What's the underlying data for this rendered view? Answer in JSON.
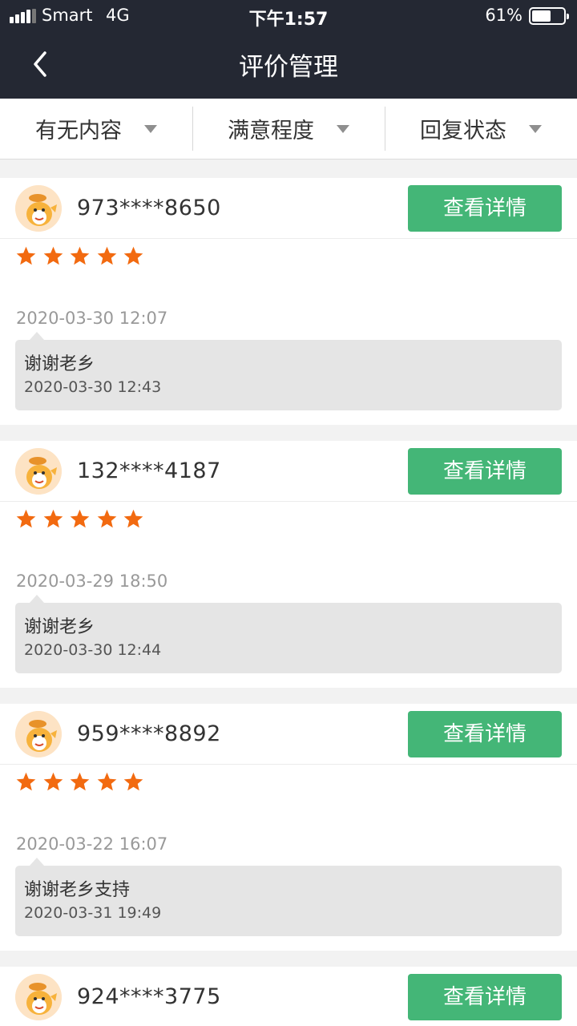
{
  "status_bar": {
    "carrier": "Smart",
    "network": "4G",
    "time": "下午1:57",
    "battery": "61%",
    "battery_level": 0.61
  },
  "navbar": {
    "title": "评价管理",
    "back_icon": "chevron-left-icon"
  },
  "filters": [
    {
      "label": "有无内容",
      "icon": "caret-down-icon"
    },
    {
      "label": "满意程度",
      "icon": "caret-down-icon"
    },
    {
      "label": "回复状态",
      "icon": "caret-down-icon"
    }
  ],
  "reviews": [
    {
      "user": "973****8650",
      "button": "查看详情",
      "rating": 5,
      "rated_at": "2020-03-30 12:07",
      "reply": "谢谢老乡",
      "replied_at": "2020-03-30 12:43"
    },
    {
      "user": "132****4187",
      "button": "查看详情",
      "rating": 5,
      "rated_at": "2020-03-29 18:50",
      "reply": "谢谢老乡",
      "replied_at": "2020-03-30 12:44"
    },
    {
      "user": "959****8892",
      "button": "查看详情",
      "rating": 5,
      "rated_at": "2020-03-22 16:07",
      "reply": "谢谢老乡支持",
      "replied_at": "2020-03-31 19:49"
    },
    {
      "user": "924****3775",
      "button": "查看详情"
    }
  ],
  "colors": {
    "header": "#242833",
    "button": "#44b677",
    "star": "#f26a10"
  }
}
